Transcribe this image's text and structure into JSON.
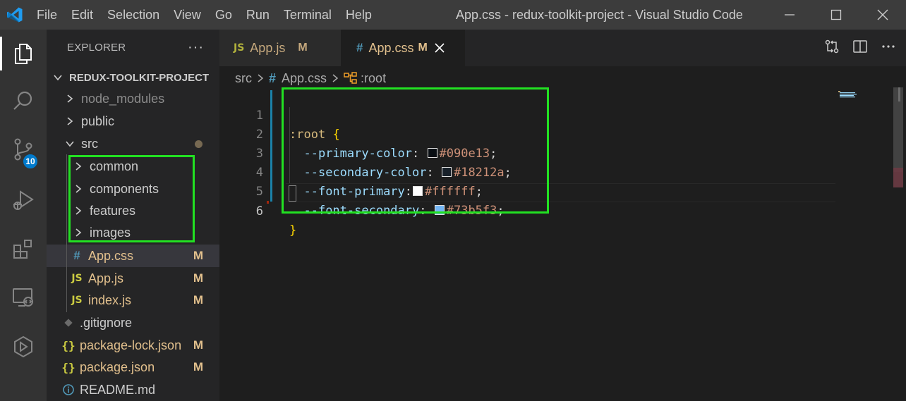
{
  "window": {
    "title": "App.css - redux-toolkit-project - Visual Studio Code",
    "menu": [
      "File",
      "Edit",
      "Selection",
      "View",
      "Go",
      "Run",
      "Terminal",
      "Help"
    ]
  },
  "activity_bar": {
    "items": [
      "explorer-icon",
      "search-icon",
      "source-control-icon",
      "run-debug-icon",
      "extensions-icon",
      "remote-explorer-icon",
      "docker-icon"
    ],
    "source_control_badge": "10"
  },
  "explorer": {
    "header": "EXPLORER",
    "more": "···",
    "root": "REDUX-TOOLKIT-PROJECT",
    "rows": [
      {
        "label": "node_modules",
        "icon": "chevron-right-icon",
        "flag": ""
      },
      {
        "label": "public",
        "icon": "chevron-right-icon",
        "flag": ""
      },
      {
        "label": "src",
        "icon": "chevron-down-icon",
        "flag": ""
      },
      {
        "label": "common",
        "icon": "chevron-right-icon",
        "flag": ""
      },
      {
        "label": "components",
        "icon": "chevron-right-icon",
        "flag": ""
      },
      {
        "label": "features",
        "icon": "chevron-right-icon",
        "flag": ""
      },
      {
        "label": "images",
        "icon": "chevron-right-icon",
        "flag": ""
      },
      {
        "label": "App.css",
        "icon": "#",
        "flag": "M"
      },
      {
        "label": "App.js",
        "icon": "JS",
        "flag": "M"
      },
      {
        "label": "index.js",
        "icon": "JS",
        "flag": "M"
      },
      {
        "label": ".gitignore",
        "icon": "git-icon",
        "flag": ""
      },
      {
        "label": "package-lock.json",
        "icon": "{}",
        "flag": "M"
      },
      {
        "label": "package.json",
        "icon": "{}",
        "flag": "M"
      },
      {
        "label": "README.md",
        "icon": "info-icon",
        "flag": ""
      }
    ]
  },
  "tabs": [
    {
      "label": "App.js",
      "icon": "JS",
      "flag": "M"
    },
    {
      "label": "App.css",
      "icon": "#",
      "flag": "M"
    }
  ],
  "breadcrumb": {
    "folder": "src",
    "file": "App.css",
    "symbol": ":root"
  },
  "code": {
    "line_numbers": [
      "1",
      "2",
      "3",
      "4",
      "5",
      "6"
    ],
    "selector": ":root",
    "open_brace": "{",
    "close_brace": "}",
    "declarations": [
      {
        "prop": "--primary-color",
        "sep": ": ",
        "value": "#090e13",
        "swatch": "#090e13"
      },
      {
        "prop": "--secondary-color",
        "sep": ": ",
        "value": "#18212a",
        "swatch": "#18212a"
      },
      {
        "prop": "--font-primary",
        "sep": ":",
        "value": "#ffffff",
        "swatch": "#ffffff"
      },
      {
        "prop": "--font-secondary",
        "sep": ": ",
        "value": "#73b5f3",
        "swatch": "#73b5f3"
      }
    ]
  },
  "colors": {
    "highlight_box": "#22e122",
    "modified": "#e2c08d",
    "accent": "#007acc"
  }
}
